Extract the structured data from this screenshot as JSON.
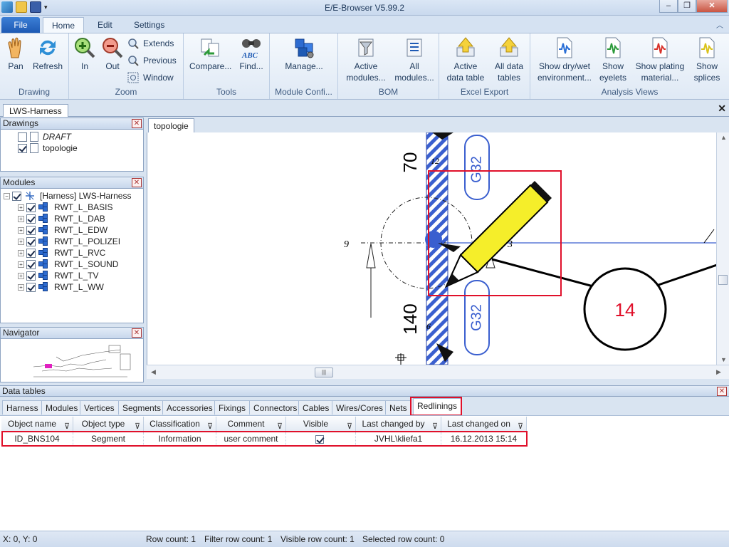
{
  "window": {
    "title": "E/E-Browser V5.99.2",
    "minimize_label": "–",
    "restore_label": "❐",
    "close_label": "✕"
  },
  "ribbon": {
    "tabs": [
      {
        "label": "File"
      },
      {
        "label": "Home"
      },
      {
        "label": "Edit"
      },
      {
        "label": "Settings"
      }
    ],
    "groups": {
      "drawing": {
        "label": "Drawing",
        "pan": "Pan",
        "refresh": "Refresh"
      },
      "zoom": {
        "label": "Zoom",
        "in": "In",
        "out": "Out",
        "extends": "Extends",
        "previous": "Previous",
        "window": "Window"
      },
      "tools": {
        "label": "Tools",
        "compare": "Compare...",
        "find": "Find..."
      },
      "module_config": {
        "label": "Module Confi...",
        "manage": "Manage..."
      },
      "bom": {
        "label": "BOM",
        "active_modules_1": "Active",
        "active_modules_2": "modules...",
        "all_modules_1": "All",
        "all_modules_2": "modules..."
      },
      "excel_export": {
        "label": "Excel Export",
        "active_data_1": "Active",
        "active_data_2": "data table",
        "all_data_1": "All data",
        "all_data_2": "tables"
      },
      "analysis": {
        "label": "Analysis Views",
        "drywet_1": "Show dry/wet",
        "drywet_2": "environment...",
        "eyelets_1": "Show",
        "eyelets_2": "eyelets",
        "plating_1": "Show plating",
        "plating_2": "material...",
        "splices_1": "Show",
        "splices_2": "splices"
      }
    }
  },
  "document_tab": "LWS-Harness",
  "drawings_panel": {
    "title": "Drawings",
    "items": [
      {
        "label": "DRAFT",
        "checked": false
      },
      {
        "label": "topologie",
        "checked": true
      }
    ]
  },
  "modules_panel": {
    "title": "Modules",
    "root": "[Harness] LWS-Harness",
    "items": [
      {
        "label": "RWT_L_BASIS"
      },
      {
        "label": "RWT_L_DAB"
      },
      {
        "label": "RWT_L_EDW"
      },
      {
        "label": "RWT_L_POLIZEI"
      },
      {
        "label": "RWT_L_RVC"
      },
      {
        "label": "RWT_L_SOUND"
      },
      {
        "label": "RWT_L_TV"
      },
      {
        "label": "RWT_L_WW"
      }
    ]
  },
  "navigator_panel": {
    "title": "Navigator"
  },
  "drawing_tab": "topologie",
  "canvas": {
    "dim_70": "70",
    "dim_140": "140",
    "label_12": "12",
    "label_9": "9",
    "label_3": "3",
    "label_6": "6",
    "g32_top": "G32",
    "g32_bottom": "G32",
    "circle_label": "14"
  },
  "data_tables": {
    "title": "Data tables",
    "tabs": [
      "Harness",
      "Modules",
      "Vertices",
      "Segments",
      "Accessories",
      "Fixings",
      "Connectors",
      "Cables",
      "Wires/Cores",
      "Nets",
      "Redlinings"
    ],
    "active_tab": "Redlinings",
    "columns": [
      "Object name",
      "Object type",
      "Classification",
      "Comment",
      "Visible",
      "Last changed by",
      "Last changed on"
    ],
    "rows": [
      {
        "object_name": "ID_BNS104",
        "object_type": "Segment",
        "classification": "Information",
        "comment": "user comment",
        "visible": true,
        "last_changed_by": "JVHL\\kliefa1",
        "last_changed_on": "16.12.2013 15:14"
      }
    ]
  },
  "status": {
    "coords": "X: 0, Y: 0",
    "row_count": "Row count: 1",
    "filter_row_count": "Filter row count: 1",
    "visible_row_count": "Visible row count: 1",
    "selected_row_count": "Selected row count: 0"
  },
  "colors": {
    "redline": "#e0102a",
    "accent_blue": "#1e5ab4",
    "pencil_yellow": "#f5ee2a",
    "harness_blue": "#3a5fcf"
  }
}
